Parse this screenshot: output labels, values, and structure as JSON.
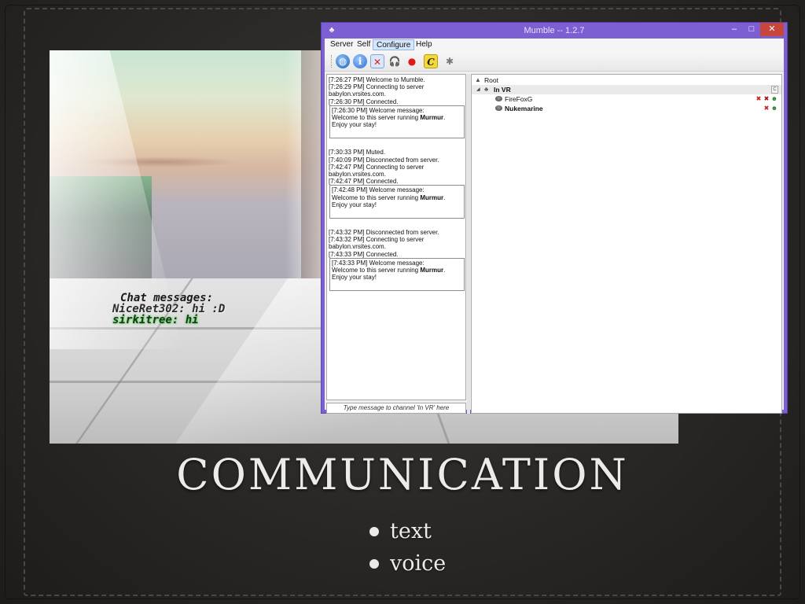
{
  "slide": {
    "title": "COMMUNICATION",
    "bullets": [
      "text",
      "voice"
    ]
  },
  "vr_scene": {
    "chat_title": "Chat messages:",
    "messages": [
      "NiceRet302: hi :D",
      "sirkitree: hi"
    ]
  },
  "mumble": {
    "window_title": "Mumble -- 1.2.7",
    "window_buttons": {
      "minimize": "–",
      "maximize": "□",
      "close": "✕"
    },
    "menu": [
      "Server",
      "Self",
      "Configure",
      "Help"
    ],
    "active_menu": "Configure",
    "toolbar_icons": [
      "connect-icon",
      "info-icon",
      "mute-self-icon",
      "deafen-icon",
      "record-icon",
      "comment-icon",
      "audio-wizard-icon"
    ],
    "toolbar_glyphs": {
      "connect": "◍",
      "info": "i",
      "mute": "✕",
      "deafen": "🎧",
      "record": "●",
      "comment": "C",
      "wizard": "✱"
    },
    "log": {
      "block1": [
        "[7:26:27 PM] Welcome to Mumble.",
        "[7:26:29 PM] Connecting to server",
        "babylon.vrsites.com.",
        "[7:26:30 PM] Connected."
      ],
      "welcome1_header": "[7:26:30 PM] Welcome message:",
      "block2": [
        "[7:30:33 PM] Muted.",
        "[7:40:09 PM] Disconnected from server.",
        "[7:42:47 PM] Connecting to server",
        "babylon.vrsites.com.",
        "[7:42:47 PM] Connected."
      ],
      "welcome2_header": "[7:42:48 PM] Welcome message:",
      "block3": [
        "[7:43:32 PM] Disconnected from server.",
        "[7:43:32 PM] Connecting to server",
        "babylon.vrsites.com.",
        "[7:43:33 PM] Connected."
      ],
      "welcome3_header": "[7:43:33 PM] Welcome message:",
      "welcome_text_prefix": "Welcome to this server running ",
      "welcome_server_name": "Murmur",
      "welcome_text_suffix": ".",
      "welcome_text_line2": "Enjoy your stay!"
    },
    "chat_placeholder": "Type message to channel 'In VR' here",
    "tree": {
      "root": "Root",
      "channel": "In VR",
      "channel_comment_glyph": "C",
      "users": [
        {
          "name": "FireFoxG",
          "bold": false,
          "status_glyphs": [
            "✖",
            "✖",
            "☻"
          ]
        },
        {
          "name": "Nukemarine",
          "bold": true,
          "status_glyphs": [
            "✖",
            "☻"
          ]
        }
      ]
    }
  }
}
